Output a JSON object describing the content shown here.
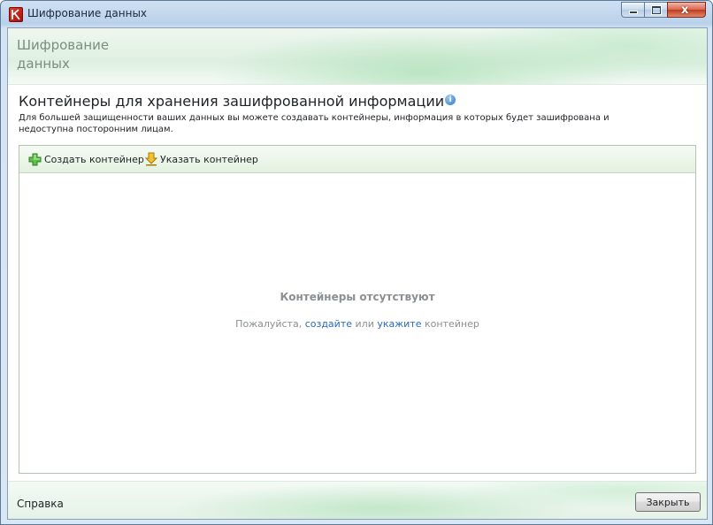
{
  "window": {
    "title": "Шифрование данных",
    "controls": {
      "minimize_icon": "minimize-icon",
      "maximize_icon": "maximize-icon",
      "close_glyph": "x"
    }
  },
  "banner": {
    "title_line1": "Шифрование",
    "title_line2": "данных"
  },
  "section": {
    "title": "Контейнеры для хранения зашифрованной информации",
    "info_glyph": "i",
    "description": "Для большей защищенности ваших данных вы можете создавать контейнеры, информация в которых будет зашифрована и недоступна посторонним лицам."
  },
  "toolbar": {
    "create_label": "Создать контейнер",
    "point_label": "Указать контейнер"
  },
  "empty_state": {
    "title": "Контейнеры отсутствуют",
    "hint_prefix": "Пожалуйста, ",
    "create_link": "создайте",
    "hint_middle": " или ",
    "point_link": "укажите",
    "hint_suffix": " контейнер"
  },
  "footer": {
    "help_label": "Справка",
    "close_label": "Закрыть"
  },
  "colors": {
    "accent_green": "#e3f1df",
    "link_blue": "#2b6bb5",
    "muted_text": "#8a8f93"
  }
}
